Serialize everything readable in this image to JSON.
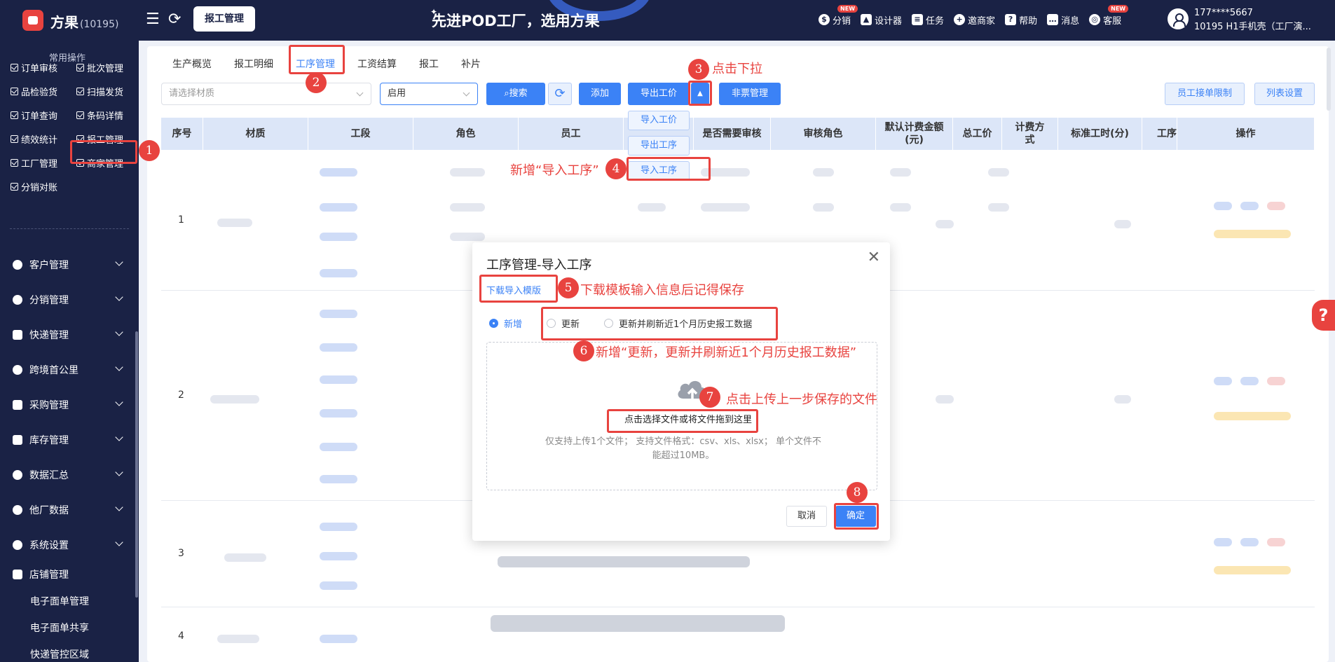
{
  "app": {
    "brand": "方果",
    "brand_count": "(10195)",
    "top_tab": "报工管理",
    "slogan": "先进POD工厂，选用方果",
    "nav": [
      {
        "label": "分销",
        "icon": "coin-icon",
        "badge": "NEW"
      },
      {
        "label": "设计器",
        "icon": "image-icon",
        "badge": ""
      },
      {
        "label": "任务",
        "icon": "task-icon",
        "badge": ""
      },
      {
        "label": "邀商家",
        "icon": "user-add-icon",
        "badge": ""
      },
      {
        "label": "帮助",
        "icon": "help-icon",
        "badge": ""
      },
      {
        "label": "消息",
        "icon": "message-icon",
        "badge": ""
      },
      {
        "label": "客服",
        "icon": "headset-icon",
        "badge": "NEW"
      }
    ],
    "user_phone": "177****5667",
    "user_org": "10195 H1手机壳（工厂演..."
  },
  "sidebar": {
    "section_title": "常用操作",
    "quick_links": [
      "订单审核",
      "批次管理",
      "品检验货",
      "扫描发货",
      "订单查询",
      "条码详情",
      "绩效统计",
      "报工管理",
      "工厂管理",
      "商家管理",
      "分销对账"
    ],
    "menus": [
      "客户管理",
      "分销管理",
      "快递管理",
      "跨境首公里",
      "采购管理",
      "库存管理",
      "数据汇总",
      "他厂数据",
      "系统设置",
      "店铺管理"
    ],
    "submenus": [
      "电子面单管理",
      "电子面单共享",
      "快递管控区域"
    ]
  },
  "tabs": [
    "生产概览",
    "报工明细",
    "工序管理",
    "工资结算",
    "报工",
    "补片"
  ],
  "active_tab": "工序管理",
  "filters": {
    "material_placeholder": "请选择材质",
    "status_value": "启用"
  },
  "toolbar": {
    "search": "搜索",
    "add": "添加",
    "export_price": "导出工价",
    "non_ticket": "非票管理",
    "staff_limit": "员工接单限制",
    "list_settings": "列表设置"
  },
  "dropdown": [
    "导入工价",
    "导出工序",
    "导入工序"
  ],
  "table": {
    "headers": [
      "序号",
      "材质",
      "工段",
      "角色",
      "员工",
      "",
      "是否需要审核",
      "审核角色",
      "默认计费金额(元)",
      "总工价",
      "计费方式",
      "标准工时(分)",
      "工序",
      "操作"
    ],
    "row_numbers": [
      "1",
      "2",
      "3",
      "4"
    ]
  },
  "modal": {
    "title": "工序管理-导入工序",
    "download_link": "下载导入模版",
    "radios": [
      "新增",
      "更新",
      "更新并刷新近1个月历史报工数据"
    ],
    "selected_radio": "新增",
    "upload_button": "点击选择文件或将文件拖到这里",
    "upload_hint": "仅支持上传1个文件；  支持文件格式：csv、xls、xlsx；  单个文件不能超过10MB。",
    "cancel": "取消",
    "confirm": "确定"
  },
  "annotations": {
    "steps": [
      "1",
      "2",
      "3",
      "4",
      "5",
      "6",
      "7",
      "8"
    ],
    "note3": "点击下拉",
    "note4": "新增“导入工序”",
    "note5": "下载模板输入信息后记得保存",
    "note6": "新增“更新，更新并刷新近1个月历史报工数据”",
    "note7": "点击上传上一步保存的文件"
  },
  "colors": {
    "sidebar_bg": "#1a2245",
    "primary": "#3b82f6",
    "annotation": "#e8433f",
    "table_header_bg": "#dce6f8"
  }
}
